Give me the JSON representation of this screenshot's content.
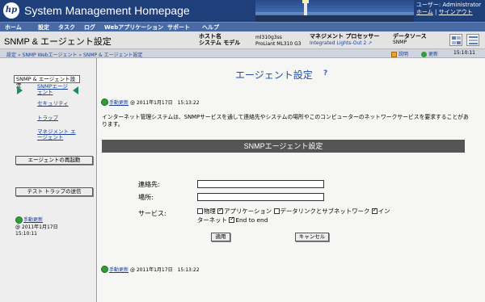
{
  "banner": {
    "logo": "hp",
    "title": "System Management Homepage",
    "user_label": "ユーザー: Administrator",
    "home_link": "ホーム",
    "link_separator": "|",
    "signout_link": "サインアウト"
  },
  "menu": [
    "ホーム",
    "設定",
    "タスク",
    "ログ",
    "Webアプリケーション",
    "サポート",
    "ヘルプ"
  ],
  "header": {
    "page_title": "SNMP & エージェント設定",
    "host_label": "ホスト名",
    "model_label": "システム モデル",
    "host_value": "ml310g3ss",
    "model_value": "ProLiant ML310 G3",
    "mp_label": "マネジメント プロセッサー",
    "mp_link": "Integrated Lights-Out 2",
    "ds_label": "データソース",
    "ds_value": "SNMP"
  },
  "breadcrumb": {
    "items": [
      "設定",
      "SNMP Webエージェント",
      "SNMP & エージェント設定"
    ],
    "separator": "»",
    "legend": "説明",
    "refresh": "更新",
    "time": "15:10:11"
  },
  "leftnav": {
    "header": "SNMP & エージェント設定",
    "items": [
      "SNMPエージェント",
      "セキュリティ",
      "トラップ",
      "マネジメント エージェント"
    ],
    "restart_button": "エージェントの再起動",
    "test_trap_button": "テスト トラップの送信",
    "refresh_link": "手動更新",
    "refresh_date": "@ 2011年1月17日",
    "refresh_time": "15:10:11"
  },
  "main": {
    "title": "エージェント設定",
    "help_icon": "?",
    "refresh_top_link": "手動更新",
    "refresh_top_time": "@ 2011年1月17日　15:13:22",
    "description": "インターネット管理システムは、SNMPサービスを通して連絡先やシステムの場所やこのコンピューターのネットワークサービスを要求することがあります。",
    "section_title": "SNMPエージェント設定",
    "contact_label": "連絡先:",
    "contact_value": "",
    "location_label": "場所:",
    "location_value": "",
    "services_label": "サービス:",
    "services": [
      {
        "label": "物理",
        "checked": false
      },
      {
        "label": "アプリケーション",
        "checked": true
      },
      {
        "label": "データリンクとサブネットワーク",
        "checked": false
      },
      {
        "label": "インターネット",
        "checked": true
      },
      {
        "label": "End to end",
        "checked": true
      }
    ],
    "apply_button": "適用",
    "cancel_button": "キャンセル",
    "refresh_bottom_link": "手動更新",
    "refresh_bottom_time": "@ 2011年1月17日　15:13:22"
  },
  "colors": {
    "banner": "#1f3f7a",
    "menubar": "#4a6aa3",
    "link": "#1a3e9e",
    "title_blue": "#1f4c9c",
    "section_bar": "#555555",
    "refresh_green": "#2f9e3a"
  }
}
